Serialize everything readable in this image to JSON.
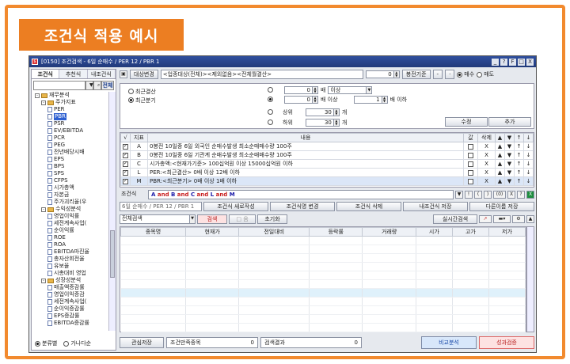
{
  "banner": "조건식 적용 예시",
  "window": {
    "title": "[0150] 조건검색 - 6일 순매수 / PER 12 / PBR 1",
    "controls": [
      "_",
      "?",
      "F",
      "□",
      "X"
    ]
  },
  "left": {
    "tabs": [
      "조건식",
      "추천식",
      "내조건식"
    ],
    "search_btn": "전체",
    "tree": [
      {
        "label": "재무분석",
        "type": "pm",
        "indent": 0
      },
      {
        "label": "주가지표",
        "type": "pm",
        "indent": 1
      },
      {
        "label": "PER",
        "type": "doc",
        "indent": 2
      },
      {
        "label": "PBR",
        "type": "doc",
        "indent": 2,
        "selected": true
      },
      {
        "label": "PSR",
        "type": "doc",
        "indent": 2
      },
      {
        "label": "EV/EBITDA",
        "type": "doc",
        "indent": 2
      },
      {
        "label": "PCR",
        "type": "doc",
        "indent": 2
      },
      {
        "label": "PEG",
        "type": "doc",
        "indent": 2
      },
      {
        "label": "전년배당시배",
        "type": "doc",
        "indent": 2
      },
      {
        "label": "EPS",
        "type": "doc",
        "indent": 2
      },
      {
        "label": "BPS",
        "type": "doc",
        "indent": 2
      },
      {
        "label": "SPS",
        "type": "doc",
        "indent": 2
      },
      {
        "label": "CFPS",
        "type": "doc",
        "indent": 2
      },
      {
        "label": "시가총액",
        "type": "doc",
        "indent": 2
      },
      {
        "label": "자본금",
        "type": "doc",
        "indent": 2
      },
      {
        "label": "주가괴리율(우",
        "type": "doc",
        "indent": 2
      },
      {
        "label": "수익성분석",
        "type": "pm",
        "indent": 1
      },
      {
        "label": "영업이익률",
        "type": "doc",
        "indent": 2
      },
      {
        "label": "세전계속사업(",
        "type": "doc",
        "indent": 2
      },
      {
        "label": "순이익률",
        "type": "doc",
        "indent": 2
      },
      {
        "label": "ROE",
        "type": "doc",
        "indent": 2
      },
      {
        "label": "ROA",
        "type": "doc",
        "indent": 2
      },
      {
        "label": "EBITDA마진율",
        "type": "doc",
        "indent": 2
      },
      {
        "label": "총자산회전율",
        "type": "doc",
        "indent": 2
      },
      {
        "label": "유보율",
        "type": "doc",
        "indent": 2
      },
      {
        "label": "시총대비 영업",
        "type": "doc",
        "indent": 2
      },
      {
        "label": "성장성분석",
        "type": "pm",
        "indent": 1
      },
      {
        "label": "매출액증감률",
        "type": "doc",
        "indent": 2
      },
      {
        "label": "영업이익증감",
        "type": "doc",
        "indent": 2
      },
      {
        "label": "세전계속사업(",
        "type": "doc",
        "indent": 2
      },
      {
        "label": "순이익증감률",
        "type": "doc",
        "indent": 2
      },
      {
        "label": "EPS증감률",
        "type": "doc",
        "indent": 2
      },
      {
        "label": "EBITDA증감률",
        "type": "doc",
        "indent": 2
      }
    ],
    "radios": [
      {
        "label": "분류별",
        "on": true
      },
      {
        "label": "가나다순",
        "on": false
      }
    ]
  },
  "toolbar": {
    "target_btn": "대상변경",
    "target_text": "<업종대상(전체)><제외없음><전체월결산>",
    "number": "0",
    "basis_btn": "봉전기준",
    "minus": "-",
    "dot": "·",
    "buy": "매수",
    "sell": "매도"
  },
  "cond": {
    "period_recent": "최근결산",
    "period_quarter": "최근분기",
    "rows": [
      {
        "val": "0",
        "u1": "배",
        "dd": "이상",
        "on": false
      },
      {
        "val": "0",
        "u1": "배 이상",
        "val2": "1",
        "u2": "배 이하",
        "on": true
      },
      {
        "label": "상위",
        "val": "30",
        "u1": "개",
        "on": false
      },
      {
        "label": "하위",
        "val": "30",
        "u1": "개",
        "on": false
      }
    ],
    "edit_btn": "수정",
    "add_btn": "추가"
  },
  "grid1": {
    "headers": [
      "√",
      "지표",
      "내용",
      "값",
      "삭제",
      "▲",
      "▼",
      "↑",
      "↓"
    ],
    "rows": [
      {
        "id": "A",
        "text": "0봉전 10일중 6일 외국인 순매수발생 최소순매매수량 100주",
        "del": "X"
      },
      {
        "id": "B",
        "text": "0봉전 10일중 6일 기관계 순매수발생 최소순매매수량 100주",
        "del": "X"
      },
      {
        "id": "C",
        "text": "시가총액:<현재가기준> 100십억원 이상 15000십억원 이하",
        "del": "X"
      },
      {
        "id": "L",
        "text": "PER:<최근결산> 0배 이상 12배 이하",
        "del": "X"
      },
      {
        "id": "M",
        "text": "PBR:<최근분기> 0배 이상 1배 이하",
        "del": "X"
      }
    ]
  },
  "expr": {
    "label": "조건식",
    "tokens": [
      "A",
      "and",
      "B",
      "and",
      "C",
      "and",
      "L",
      "and",
      "M"
    ],
    "ops": [
      "▼",
      "!",
      "(",
      ")",
      "(0)",
      "X",
      "?"
    ]
  },
  "btnrow": {
    "name": "6일 순매수 / PER 12 / PBR 1",
    "new_btn": "조건식 새로작성",
    "rename_btn": "조건식명 변경",
    "delete_btn": "조건식 삭제",
    "save_btn": "내조건식 저장",
    "saveas_btn": "다른이름 저장"
  },
  "toolbar2": {
    "dd": "전체검색",
    "search_btn": "검색",
    "list_btn": "□ 음",
    "reset_btn": "초기화",
    "realtime_btn": "실시간검색"
  },
  "grid2": {
    "headers": [
      "종목명",
      "현재가",
      "전일대비",
      "등락률",
      "거래량",
      "시가",
      "고가",
      "저가"
    ]
  },
  "status": {
    "watch_btn": "관심저장",
    "cond_label": "조건만족종목",
    "cond_value": "0",
    "result_label": "검색결과",
    "result_value": "0",
    "compare_btn": "비교분석",
    "perf_btn": "성과검증"
  }
}
